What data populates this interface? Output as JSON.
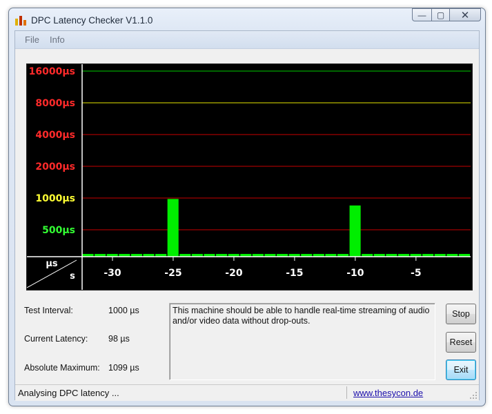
{
  "window": {
    "title": "DPC Latency Checker V1.1.0",
    "controls": {
      "minimize": "—",
      "maximize": "▢",
      "close": "✕"
    }
  },
  "menu": {
    "items": [
      "File",
      "Info"
    ]
  },
  "graph": {
    "y_labels": [
      {
        "text": "16000µs",
        "color": "#ff2a2a"
      },
      {
        "text": "8000µs",
        "color": "#ff2a2a"
      },
      {
        "text": "4000µs",
        "color": "#ff2a2a"
      },
      {
        "text": "2000µs",
        "color": "#ff2a2a"
      },
      {
        "text": "1000µs",
        "color": "#ffff33"
      },
      {
        "text": "500µs",
        "color": "#33ff33"
      }
    ],
    "line_colors": [
      "#c80000",
      "#c80000",
      "#c80000",
      "#c80000",
      "#e6e600",
      "#00d000"
    ],
    "corner": {
      "y_unit": "µs",
      "x_unit": "s"
    },
    "x_ticks": [
      "-30",
      "-25",
      "-20",
      "-15",
      "-10",
      "-5"
    ],
    "bar_color": "#00ee00"
  },
  "chart_data": {
    "type": "bar",
    "x": [
      -32,
      -31,
      -30,
      -29,
      -28,
      -27,
      -26,
      -25,
      -24,
      -23,
      -22,
      -21,
      -20,
      -19,
      -18,
      -17,
      -16,
      -15,
      -14,
      -13,
      -12,
      -11,
      -10,
      -9,
      -8,
      -7,
      -6,
      -5,
      -4,
      -3,
      -2,
      -1
    ],
    "values": [
      100,
      100,
      100,
      110,
      100,
      100,
      115,
      980,
      100,
      100,
      105,
      105,
      115,
      85,
      90,
      120,
      110,
      100,
      120,
      110,
      100,
      230,
      850,
      85,
      100,
      95,
      105,
      105,
      100,
      115,
      130,
      100
    ],
    "y_scale": "log2",
    "y_ticks": [
      500,
      1000,
      2000,
      4000,
      8000,
      16000
    ],
    "y_unit": "µs",
    "x_unit": "s",
    "x_ticks": [
      -30,
      -25,
      -20,
      -15,
      -10,
      -5
    ]
  },
  "info": {
    "test_interval_label": "Test Interval:",
    "test_interval_value": "1000 µs",
    "current_latency_label": "Current Latency:",
    "current_latency_value": "98 µs",
    "absolute_max_label": "Absolute Maximum:",
    "absolute_max_value": "1099 µs"
  },
  "message": "This machine should be able to handle real-time streaming of audio and/or video data without drop-outs.",
  "buttons": {
    "stop": "Stop",
    "reset": "Reset",
    "exit": "Exit"
  },
  "status": {
    "text": "Analysing DPC latency ...",
    "link": "www.thesycon.de"
  }
}
